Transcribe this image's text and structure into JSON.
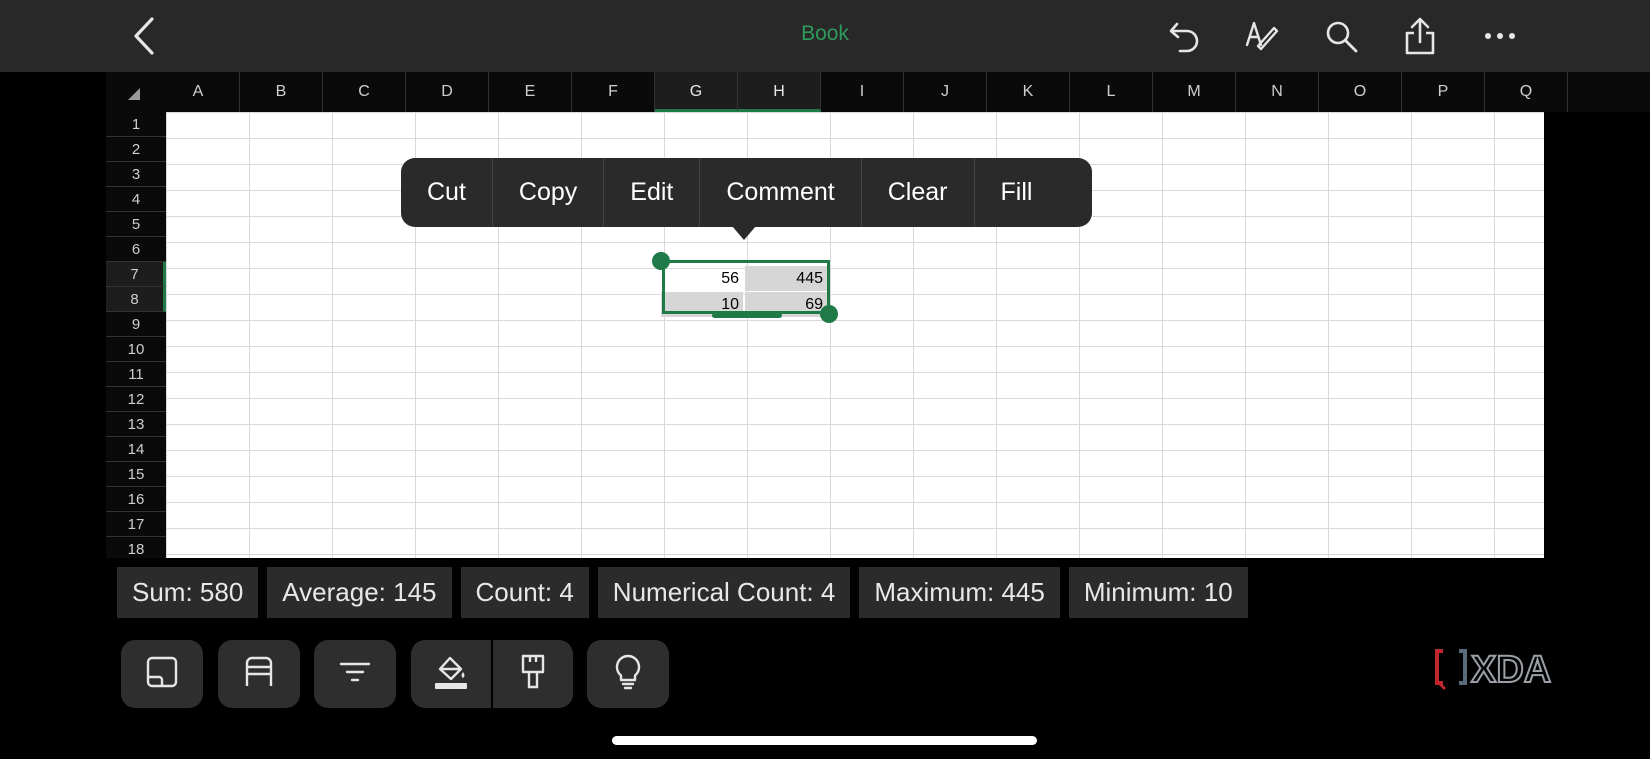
{
  "app": {
    "title": "Book"
  },
  "toolbar": {
    "icons": [
      "back-icon",
      "undo-icon",
      "draw-icon",
      "search-icon",
      "share-icon",
      "more-icon"
    ]
  },
  "grid": {
    "columns": [
      "A",
      "B",
      "C",
      "D",
      "E",
      "F",
      "G",
      "H",
      "I",
      "J",
      "K",
      "L",
      "M",
      "N",
      "O",
      "P",
      "Q"
    ],
    "rows": [
      "1",
      "2",
      "3",
      "4",
      "5",
      "6",
      "7",
      "8",
      "9",
      "10",
      "11",
      "12",
      "13",
      "14",
      "15",
      "16",
      "17",
      "18"
    ],
    "selected_columns": [
      "G",
      "H"
    ],
    "selected_rows": [
      "7",
      "8"
    ],
    "cells": {
      "G7": "56",
      "H7": "445",
      "G8": "10",
      "H8": "69"
    }
  },
  "context_menu": {
    "items": [
      "Cut",
      "Copy",
      "Edit",
      "Comment",
      "Clear",
      "Fill"
    ]
  },
  "status": {
    "sum": "Sum: 580",
    "average": "Average: 145",
    "count": "Count: 4",
    "numerical_count": "Numerical Count: 4",
    "maximum": "Maximum: 445",
    "minimum": "Minimum: 10"
  },
  "bottom_tools": [
    "panel-toggle-icon",
    "table-icon",
    "filter-icon",
    "fill-color-icon",
    "format-painter-icon",
    "lightbulb-icon"
  ],
  "watermark": {
    "text": "XDA"
  },
  "colors": {
    "accent": "#1f7a47",
    "title": "#2f9a5c"
  }
}
